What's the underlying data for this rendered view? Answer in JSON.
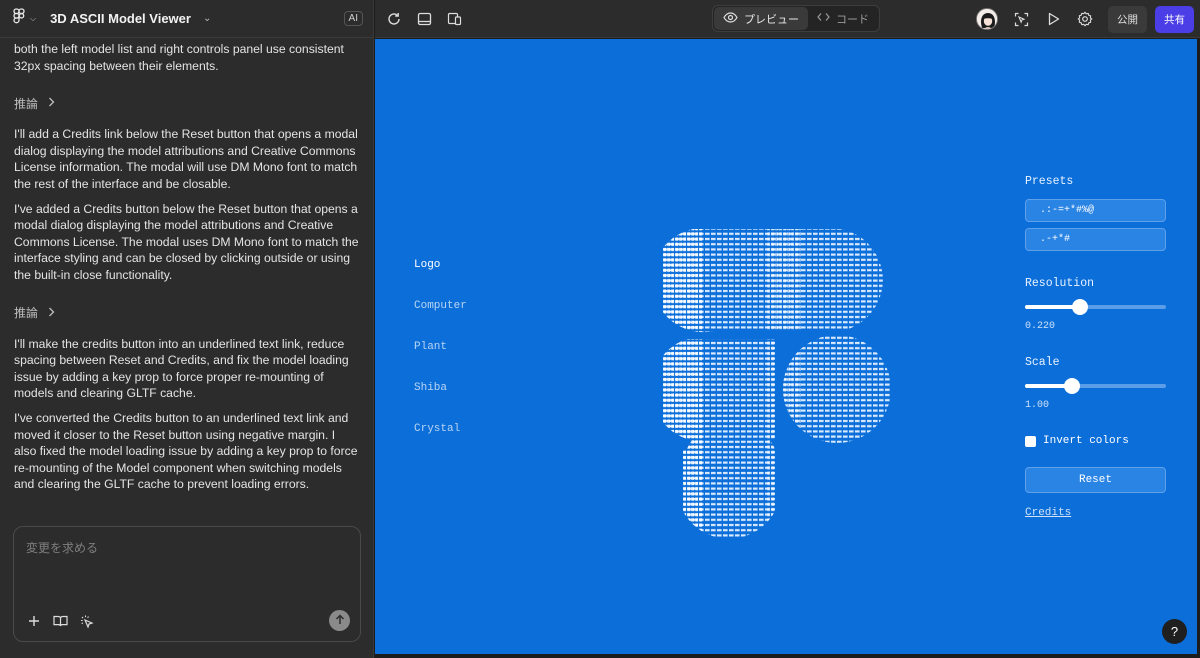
{
  "app": {
    "title": "3D ASCII Model Viewer",
    "ai_badge": "AI"
  },
  "chat": {
    "messages": [
      "both the left model list and right controls panel use consistent 32px spacing between their elements.",
      "I'll add a Credits link below the Reset button that opens a modal dialog displaying the model attributions and Creative Commons License information. The modal will use DM Mono font to match the rest of the interface and be closable.",
      "I've added a Credits button below the Reset button that opens a modal dialog displaying the model attributions and Creative Commons License. The modal uses DM Mono font to match the interface styling and can be closed by clicking outside or using the built-in close functionality.",
      "I'll make the credits button into an underlined text link, reduce spacing between Reset and Credits, and fix the model loading issue by adding a key prop to force proper re-mounting of models and clearing GLTF cache.",
      "I've converted the Credits button to an underlined text link and moved it closer to the Reset button using negative margin. I also fixed the model loading issue by adding a key prop to force re-mounting of the Model component when switching models and clearing the GLTF cache to prevent loading errors."
    ],
    "reasoning_label": "推論",
    "input_placeholder": "変更を求める"
  },
  "toolbar": {
    "preview_label": "プレビュー",
    "code_label": "コード",
    "publish_label": "公開",
    "share_label": "共有"
  },
  "preview": {
    "models": [
      "Logo",
      "Computer",
      "Plant",
      "Shiba",
      "Crystal"
    ],
    "active_model": "Logo",
    "presets_label": "Presets",
    "presets": [
      " .:-=+*#%@",
      " .-+*#"
    ],
    "resolution_label": "Resolution",
    "resolution_value": "0.220",
    "resolution_fraction": 0.39,
    "scale_label": "Scale",
    "scale_value": "1.00",
    "scale_fraction": 0.33,
    "invert_label": "Invert colors",
    "invert_checked": false,
    "reset_label": "Reset",
    "credits_label": "Credits",
    "help_label": "?"
  },
  "colors": {
    "preview_bg": "#0b6ed9",
    "share_button": "#4b3ee6",
    "panel_bg": "#2c2c2c"
  },
  "icons": {
    "figma": "figma-logo-icon",
    "refresh": "refresh-icon",
    "layout": "panel-layout-icon",
    "device": "device-preview-icon",
    "eye": "eye-icon",
    "code": "code-icon",
    "inspect": "inspect-icon",
    "play": "play-icon",
    "settings": "gear-icon",
    "plus": "plus-icon",
    "book": "book-icon",
    "select": "select-element-icon",
    "send": "send-arrow-icon"
  }
}
